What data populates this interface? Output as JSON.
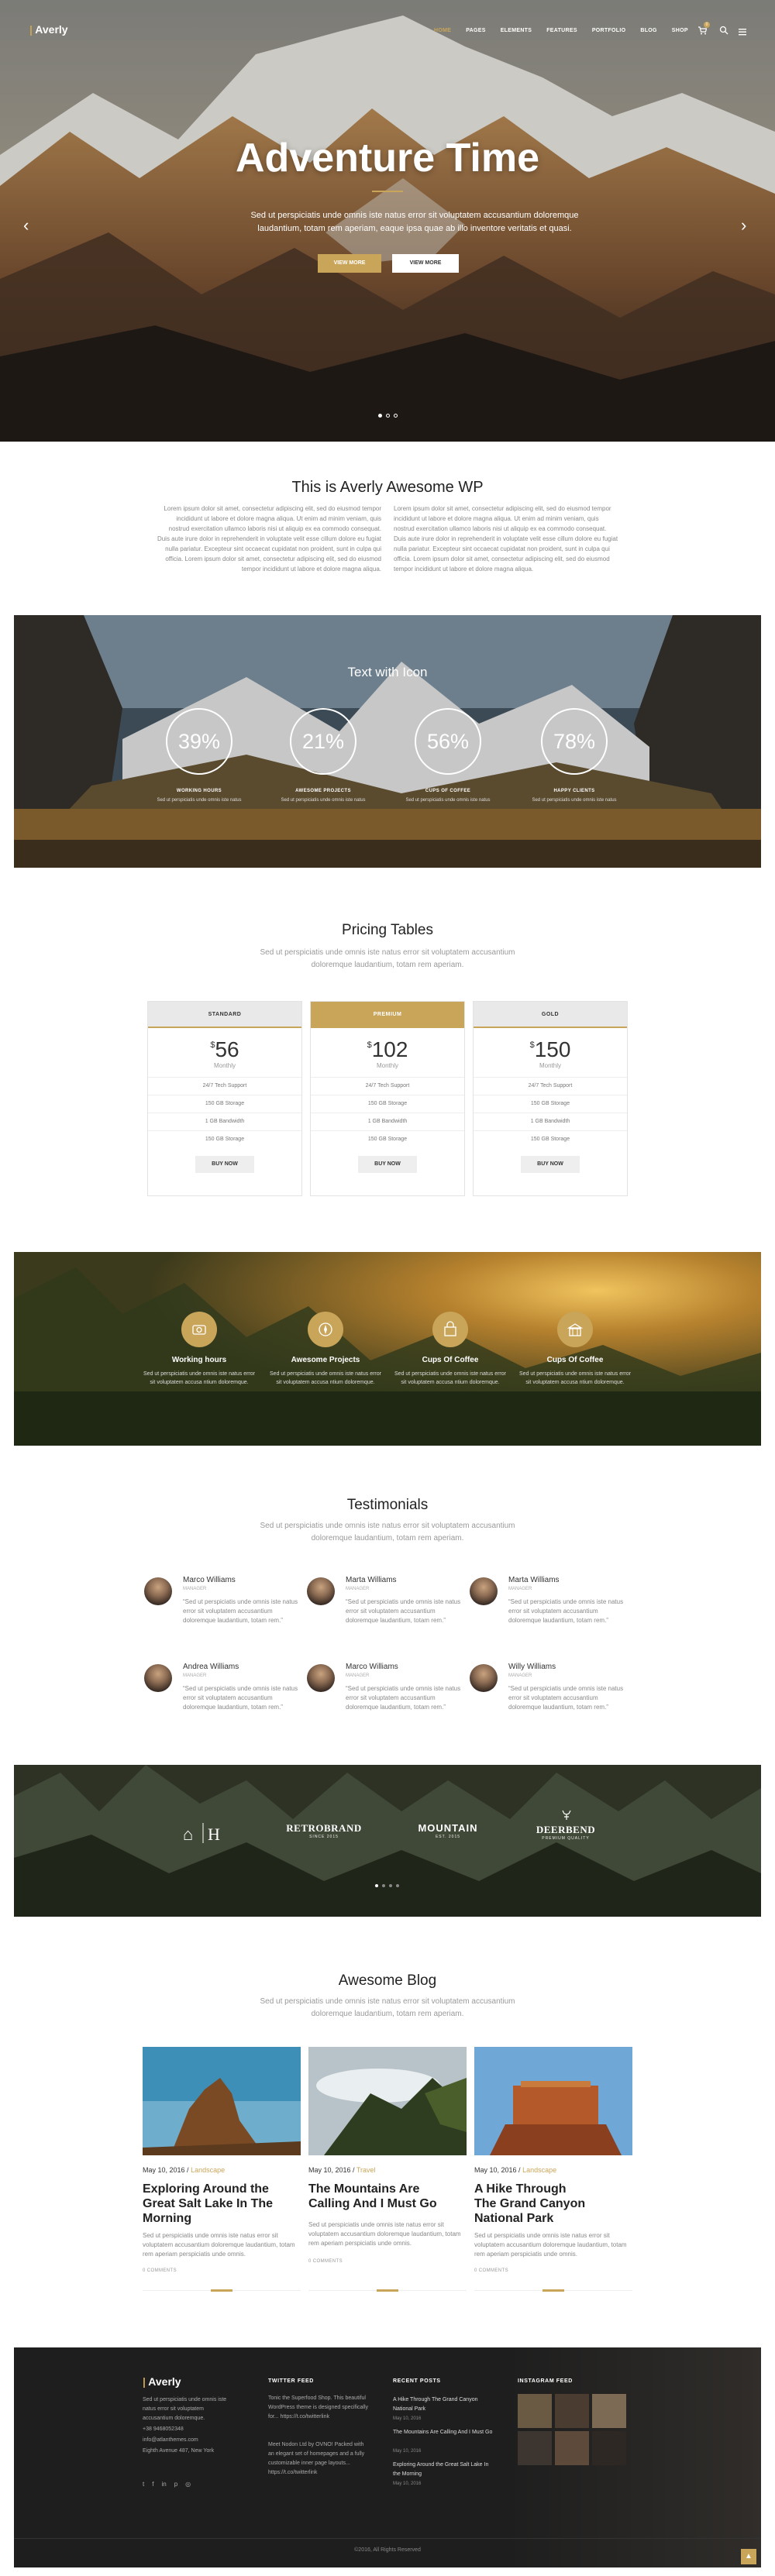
{
  "header": {
    "logo": "Averly",
    "nav": [
      "HOME",
      "PAGES",
      "ELEMENTS",
      "FEATURES",
      "PORTFOLIO",
      "BLOG",
      "SHOP"
    ],
    "cart_count": "0"
  },
  "hero": {
    "title": "Adventure Time",
    "text": "Sed ut perspiciatis unde omnis iste natus error sit voluptatem accusantium doloremque laudantium, totam rem aperiam, eaque ipsa quae ab illo inventore veritatis et quasi.",
    "btn_primary": "VIEW MORE",
    "btn_secondary": "VIEW MORE"
  },
  "intro": {
    "title": "This is Averly Awesome WP",
    "col1": "Lorem ipsum dolor sit amet, consectetur adipiscing elit, sed do eiusmod tempor incididunt ut labore et dolore magna aliqua. Ut enim ad minim veniam, quis nostrud exercitation ullamco laboris nisi ut aliquip ex ea commodo consequat. Duis aute irure dolor in reprehenderit in voluptate velit esse cillum dolore eu fugiat nulla pariatur. Excepteur sint occaecat cupidatat non proident, sunt in culpa qui officia. Lorem ipsum dolor sit amet, consectetur adipiscing elit, sed do eiusmod tempor incididunt ut labore et dolore magna aliqua.",
    "col2": "Lorem ipsum dolor sit amet, consectetur adipiscing elit, sed do eiusmod tempor incididunt ut labore et dolore magna aliqua. Ut enim ad minim veniam, quis nostrud exercitation ullamco laboris nisi ut aliquip ex ea commodo consequat. Duis aute irure dolor in reprehenderit in voluptate velit esse cillum dolore eu fugiat nulla pariatur. Excepteur sint occaecat cupidatat non proident, sunt in culpa qui officia. Lorem ipsum dolor sit amet, consectetur adipiscing elit, sed do eiusmod tempor incididunt ut labore et dolore magna aliqua."
  },
  "counters": {
    "title": "Text with Icon",
    "items": [
      {
        "value": "39%",
        "label": "WORKING HOURS",
        "text": "Sed ut perspiciatis unde omnis iste natus"
      },
      {
        "value": "21%",
        "label": "AWESOME PROJECTS",
        "text": "Sed ut perspiciatis unde omnis iste natus"
      },
      {
        "value": "56%",
        "label": "CUPS OF COFFEE",
        "text": "Sed ut perspiciatis unde omnis iste natus"
      },
      {
        "value": "78%",
        "label": "HAPPY CLIENTS",
        "text": "Sed ut perspiciatis unde omnis iste natus"
      }
    ]
  },
  "pricing": {
    "title": "Pricing Tables",
    "subtitle": "Sed ut perspiciatis unde omnis iste natus error sit voluptatem accusantium doloremque laudantium, totam rem aperiam.",
    "plans": [
      {
        "name": "STANDARD",
        "currency": "$",
        "price": "56",
        "period": "Monthly",
        "features": [
          "24/7 Tech Support",
          "150 GB Storage",
          "1 GB Bandwidth",
          "150 GB Storage"
        ],
        "button": "BUY NOW"
      },
      {
        "name": "PREMIUM",
        "currency": "$",
        "price": "102",
        "period": "Monthly",
        "features": [
          "24/7 Tech Support",
          "150 GB Storage",
          "1 GB Bandwidth",
          "150 GB Storage"
        ],
        "button": "BUY NOW"
      },
      {
        "name": "GOLD",
        "currency": "$",
        "price": "150",
        "period": "Monthly",
        "features": [
          "24/7 Tech Support",
          "150 GB Storage",
          "1 GB Bandwidth",
          "150 GB Storage"
        ],
        "button": "BUY NOW"
      }
    ]
  },
  "features": {
    "items": [
      {
        "icon": "camera-icon",
        "title": "Working hours",
        "text": "Sed ut perspiciatis unde omnis iste natus error sit voluptatem accusa ntium doloremque."
      },
      {
        "icon": "compass-icon",
        "title": "Awesome Projects",
        "text": "Sed ut perspiciatis unde omnis iste natus error sit voluptatem accusa ntium doloremque."
      },
      {
        "icon": "bag-icon",
        "title": "Cups Of Coffee",
        "text": "Sed ut perspiciatis unde omnis iste natus error sit voluptatem accusa ntium doloremque."
      },
      {
        "icon": "building-icon",
        "title": "Cups Of Coffee",
        "text": "Sed ut perspiciatis unde omnis iste natus error sit voluptatem accusa ntium doloremque."
      }
    ]
  },
  "testimonials": {
    "title": "Testimonials",
    "subtitle": "Sed ut perspiciatis unde omnis iste natus error sit voluptatem accusantium doloremque laudantium, totam rem aperiam.",
    "items": [
      {
        "name": "Marco Williams",
        "role": "MANAGER",
        "text": "“Sed ut perspiciatis unde omnis iste natus error sit voluptatem accusantium doloremque laudantium, totam rem.”"
      },
      {
        "name": "Marta Williams",
        "role": "MANAGER",
        "text": "“Sed ut perspiciatis unde omnis iste natus error sit voluptatem accusantium doloremque laudantium, totam rem.”"
      },
      {
        "name": "Marta Williams",
        "role": "MANAGER",
        "text": "“Sed ut perspiciatis unde omnis iste natus error sit voluptatem accusantium doloremque laudantium, totam rem.”"
      },
      {
        "name": "Andrea Williams",
        "role": "MANAGER",
        "text": "“Sed ut perspiciatis unde omnis iste natus error sit voluptatem accusantium doloremque laudantium, totam rem.”"
      },
      {
        "name": "Marco Williams",
        "role": "MANAGER",
        "text": "“Sed ut perspiciatis unde omnis iste natus error sit voluptatem accusantium doloremque laudantium, totam rem.”"
      },
      {
        "name": "Willy Williams",
        "role": "MANAGER",
        "text": "“Sed ut perspiciatis unde omnis iste natus error sit voluptatem accusantium doloremque laudantium, totam rem.”"
      }
    ]
  },
  "clients": {
    "logos": [
      "RETROBRAND",
      "MOUNTAIN",
      "DEERBEND"
    ],
    "logo_subtexts": [
      "SINCE 2015",
      "EST. 2015",
      "PREMIUM QUALITY"
    ]
  },
  "blog": {
    "title": "Awesome Blog",
    "subtitle": "Sed ut perspiciatis unde omnis iste natus error sit voluptatem accusantium doloremque laudantium, totam rem aperiam.",
    "posts": [
      {
        "date": "May 10, 2016",
        "category": "Landscape",
        "title": "Exploring Around the Great Salt Lake In The Morning",
        "text": "Sed ut perspiciatis unde omnis iste natus error sit voluptatem accusantium doloremque laudantium, totam rem aperiam perspiciatis unde omnis.",
        "comments": "0 COMMENTS"
      },
      {
        "date": "May 10, 2016",
        "category": "Travel",
        "title": "The Mountains Are Calling And I Must Go",
        "text": "Sed ut perspiciatis unde omnis iste natus error sit voluptatem accusantium doloremque laudantium, totam rem aperiam perspiciatis unde omnis.",
        "comments": "0 COMMENTS"
      },
      {
        "date": "May 10, 2016",
        "category": "Landscape",
        "title": "A Hike Through The Grand Canyon National Park",
        "text": "Sed ut perspiciatis unde omnis iste natus error sit voluptatem accusantium doloremque laudantium, totam rem aperiam perspiciatis unde omnis.",
        "comments": "0 COMMENTS"
      }
    ]
  },
  "footer": {
    "logo": "Averly",
    "about": "Sed ut perspiciatis unde omnis iste natus error sit voluptatem accusantium doloremque.",
    "phone": "+38 9468052348",
    "email": "info@atlanthemes.com",
    "address": "Eighth Avenue 487, New York",
    "twitter_title": "TWITTER FEED",
    "tweets": [
      "Tonic the Superfood Shop. This beautiful WordPress theme is designed specifically for... https://t.co/twitterlink",
      "Meet Nodon Ltd by OVNO! Packed with an elegant set of homepages and a fully customizable inner page layouts... https://t.co/twitterlink"
    ],
    "recent_title": "RECENT POSTS",
    "recent": [
      {
        "title": "A Hike Through The Grand Canyon National Park",
        "date": "May 10, 2016"
      },
      {
        "title": "The Mountains Are Calling And I Must Go",
        "date": "May 10, 2016"
      },
      {
        "title": "Exploring Around the Great Salt Lake In the Morning",
        "date": "May 10, 2016"
      }
    ],
    "instagram_title": "INSTAGRAM FEED",
    "copyright": "©2016, All Rights Reserved"
  }
}
